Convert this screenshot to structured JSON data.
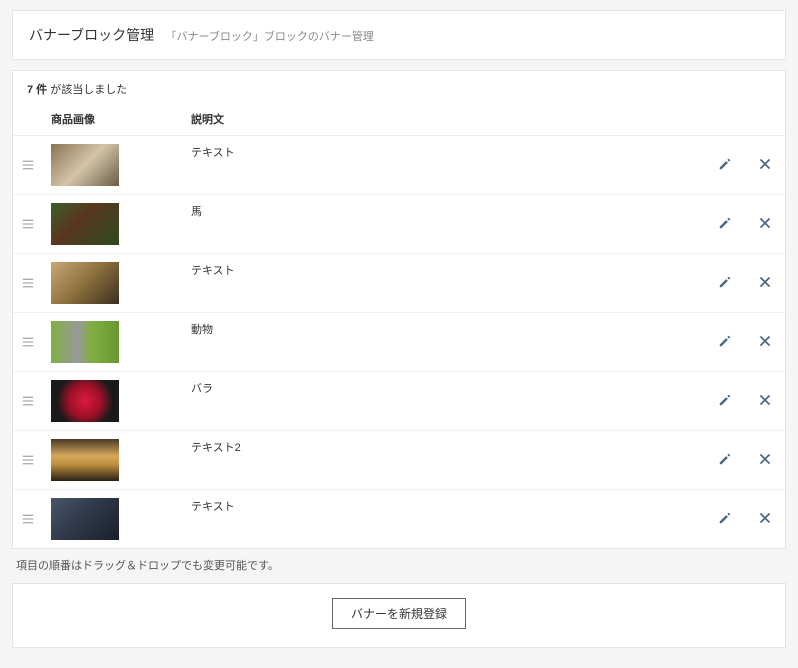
{
  "header": {
    "title": "バナーブロック管理",
    "subtitle": "「バナーブロック」ブロックのバナー管理"
  },
  "list": {
    "count_prefix": "7 件",
    "count_suffix": " が該当しました",
    "columns": {
      "image": "商品画像",
      "desc": "説明文"
    },
    "rows": [
      {
        "desc": "テキスト"
      },
      {
        "desc": "馬"
      },
      {
        "desc": "テキスト"
      },
      {
        "desc": "動物"
      },
      {
        "desc": "バラ"
      },
      {
        "desc": "テキスト2"
      },
      {
        "desc": "テキスト"
      }
    ]
  },
  "note": "項目の順番はドラッグ＆ドロップでも変更可能です。",
  "register_button": "バナーを新規登録"
}
